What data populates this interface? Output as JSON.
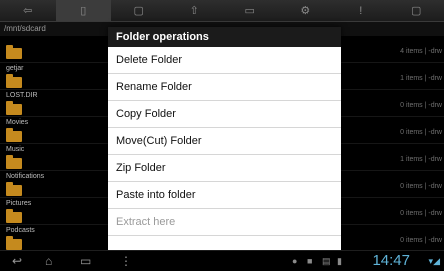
{
  "toolbar": {
    "buttons": [
      {
        "icon": "back-arrow-icon",
        "glyph": "⇦"
      },
      {
        "icon": "sdcard-icon",
        "glyph": "▯"
      },
      {
        "icon": "document-icon",
        "glyph": "▢"
      },
      {
        "icon": "arrow-up-icon",
        "glyph": "⇧"
      },
      {
        "icon": "image-icon",
        "glyph": "▭"
      },
      {
        "icon": "gear-icon",
        "glyph": "⚙"
      },
      {
        "icon": "info-icon",
        "glyph": "!"
      },
      {
        "icon": "new-document-icon",
        "glyph": "▢"
      }
    ]
  },
  "path": "/mnt/sdcard",
  "files": [
    {
      "name": "",
      "meta": "4 items | -drw"
    },
    {
      "name": "getjar",
      "meta": "1 items | -drw"
    },
    {
      "name": "LOST.DIR",
      "meta": "0 items | -drw"
    },
    {
      "name": "Movies",
      "meta": "0 items | -drw"
    },
    {
      "name": "Music",
      "meta": "1 items | -drw"
    },
    {
      "name": "Notifications",
      "meta": "0 items | -drw"
    },
    {
      "name": "Pictures",
      "meta": "0 items | -drw"
    },
    {
      "name": "Podcasts",
      "meta": "0 items | -drw"
    }
  ],
  "dialog": {
    "title": "Folder operations",
    "items": [
      {
        "label": "Delete Folder",
        "enabled": true
      },
      {
        "label": "Rename Folder",
        "enabled": true
      },
      {
        "label": "Copy Folder",
        "enabled": true
      },
      {
        "label": "Move(Cut) Folder",
        "enabled": true
      },
      {
        "label": "Zip Folder",
        "enabled": true
      },
      {
        "label": "Paste into folder",
        "enabled": true
      },
      {
        "label": "Extract here",
        "enabled": false
      }
    ]
  },
  "navbar": {
    "clock": "14:47",
    "signal": "▾◢"
  },
  "colors": {
    "folder": "#c58a1e",
    "clock": "#5fb3d8",
    "dialog_title_bg": "#1b1b1b"
  }
}
